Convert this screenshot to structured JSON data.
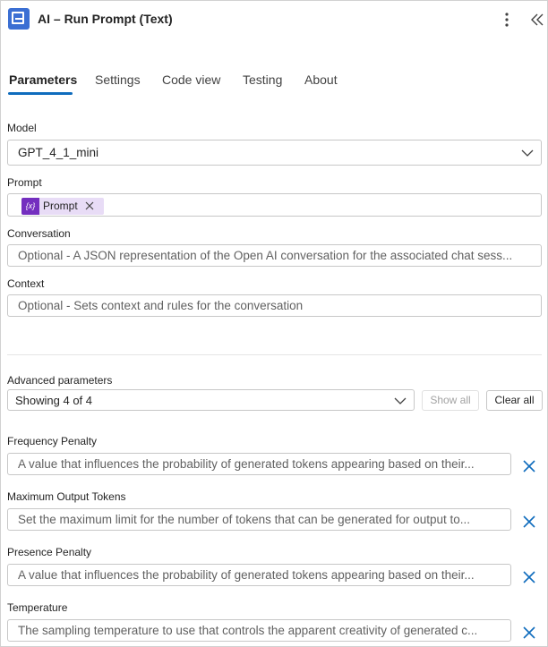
{
  "header": {
    "title": "AI – Run Prompt (Text)"
  },
  "tabs": [
    "Parameters",
    "Settings",
    "Code view",
    "Testing",
    "About"
  ],
  "model": {
    "label": "Model",
    "value": "GPT_4_1_mini"
  },
  "prompt": {
    "label": "Prompt",
    "token_label": "Prompt",
    "token_icon": "{x}"
  },
  "conversation": {
    "label": "Conversation",
    "placeholder": "Optional - A JSON representation of the Open AI conversation for the associated chat sess..."
  },
  "context": {
    "label": "Context",
    "placeholder": "Optional - Sets context and rules for the conversation"
  },
  "advanced": {
    "label": "Advanced parameters",
    "select_value": "Showing 4 of 4",
    "show_all": "Show all",
    "clear_all": "Clear all"
  },
  "params": [
    {
      "label": "Frequency Penalty",
      "placeholder": "A value that influences the probability of generated tokens appearing based on their..."
    },
    {
      "label": "Maximum Output Tokens",
      "placeholder": "Set the maximum limit for the number of tokens that can be generated for output to..."
    },
    {
      "label": "Presence Penalty",
      "placeholder": "A value that influences the probability of generated tokens appearing based on their..."
    },
    {
      "label": "Temperature",
      "placeholder": "The sampling temperature to use that controls the apparent creativity of generated c..."
    }
  ],
  "colors": {
    "accent": "#0f6cbd",
    "token_bg": "#e8dcf6",
    "token_icon": "#742fbf",
    "app_icon": "#3b6fd3"
  }
}
